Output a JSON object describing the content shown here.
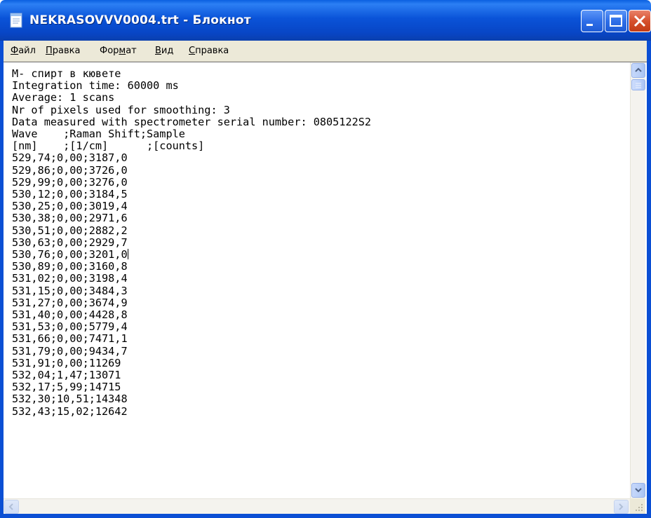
{
  "window": {
    "title": "NEKRASOVVV0004.trt - Блокнот",
    "icon": "notepad-icon",
    "buttons": {
      "minimize": "minimize-icon",
      "maximize": "maximize-icon",
      "close": "close-icon"
    }
  },
  "menu": [
    {
      "label": "Файл",
      "mnemonic": "Ф"
    },
    {
      "label": "Правка",
      "mnemonic": "П"
    },
    {
      "label": "Формат",
      "mnemonic": "м"
    },
    {
      "label": "Вид",
      "mnemonic": "В"
    },
    {
      "label": "Справка",
      "mnemonic": "С"
    }
  ],
  "document": {
    "lines": [
      "M- спирт в кювете",
      "Integration time: 60000 ms",
      "Average: 1 scans",
      "Nr of pixels used for smoothing: 3",
      "Data measured with spectrometer serial number: 0805122S2",
      "Wave    ;Raman Shift;Sample",
      "[nm]    ;[1/cm]      ;[counts]",
      "529,74;0,00;3187,0",
      "529,86;0,00;3726,0",
      "529,99;0,00;3276,0",
      "530,12;0,00;3184,5",
      "530,25;0,00;3019,4",
      "530,38;0,00;2971,6",
      "530,51;0,00;2882,2",
      "530,63;0,00;2929,7",
      "530,76;0,00;3201,0",
      "530,89;0,00;3160,8",
      "531,02;0,00;3198,4",
      "531,15;0,00;3484,3",
      "531,27;0,00;3674,9",
      "531,40;0,00;4428,8",
      "531,53;0,00;5779,4",
      "531,66;0,00;7471,1",
      "531,79;0,00;9434,7",
      "531,91;0,00;11269",
      "532,04;1,47;13071",
      "532,17;5,99;14715",
      "532,30;10,51;14348",
      "532,43;15,02;12642"
    ],
    "caret_line": 15
  },
  "colors": {
    "title_bar": "#0a53d8",
    "menu_bg": "#ece9d8",
    "close_button": "#d6512e"
  }
}
